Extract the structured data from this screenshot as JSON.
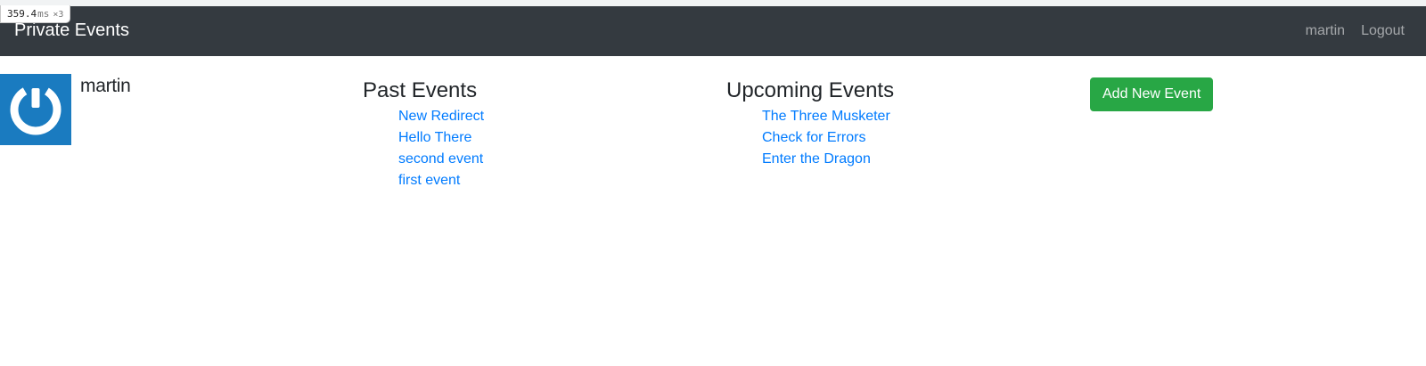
{
  "perf": {
    "value": "359.4",
    "unit": "ms",
    "multiplier": "×3"
  },
  "navbar": {
    "brand": "Private Events",
    "links": [
      {
        "label": "martin"
      },
      {
        "label": "Logout"
      }
    ]
  },
  "profile": {
    "avatar_icon": "power-icon",
    "username": "martin"
  },
  "past_events": {
    "heading": "Past Events",
    "items": [
      {
        "label": "New Redirect"
      },
      {
        "label": "Hello There"
      },
      {
        "label": "second event"
      },
      {
        "label": "first event"
      }
    ]
  },
  "upcoming_events": {
    "heading": "Upcoming Events",
    "items": [
      {
        "label": "The Three Musketer"
      },
      {
        "label": "Check for Errors"
      },
      {
        "label": "Enter the Dragon"
      }
    ]
  },
  "actions": {
    "add_event_label": "Add New Event"
  },
  "colors": {
    "navbar_bg": "#343a40",
    "link": "#007bff",
    "success": "#28a745",
    "avatar_bg": "#1a7bc0"
  }
}
